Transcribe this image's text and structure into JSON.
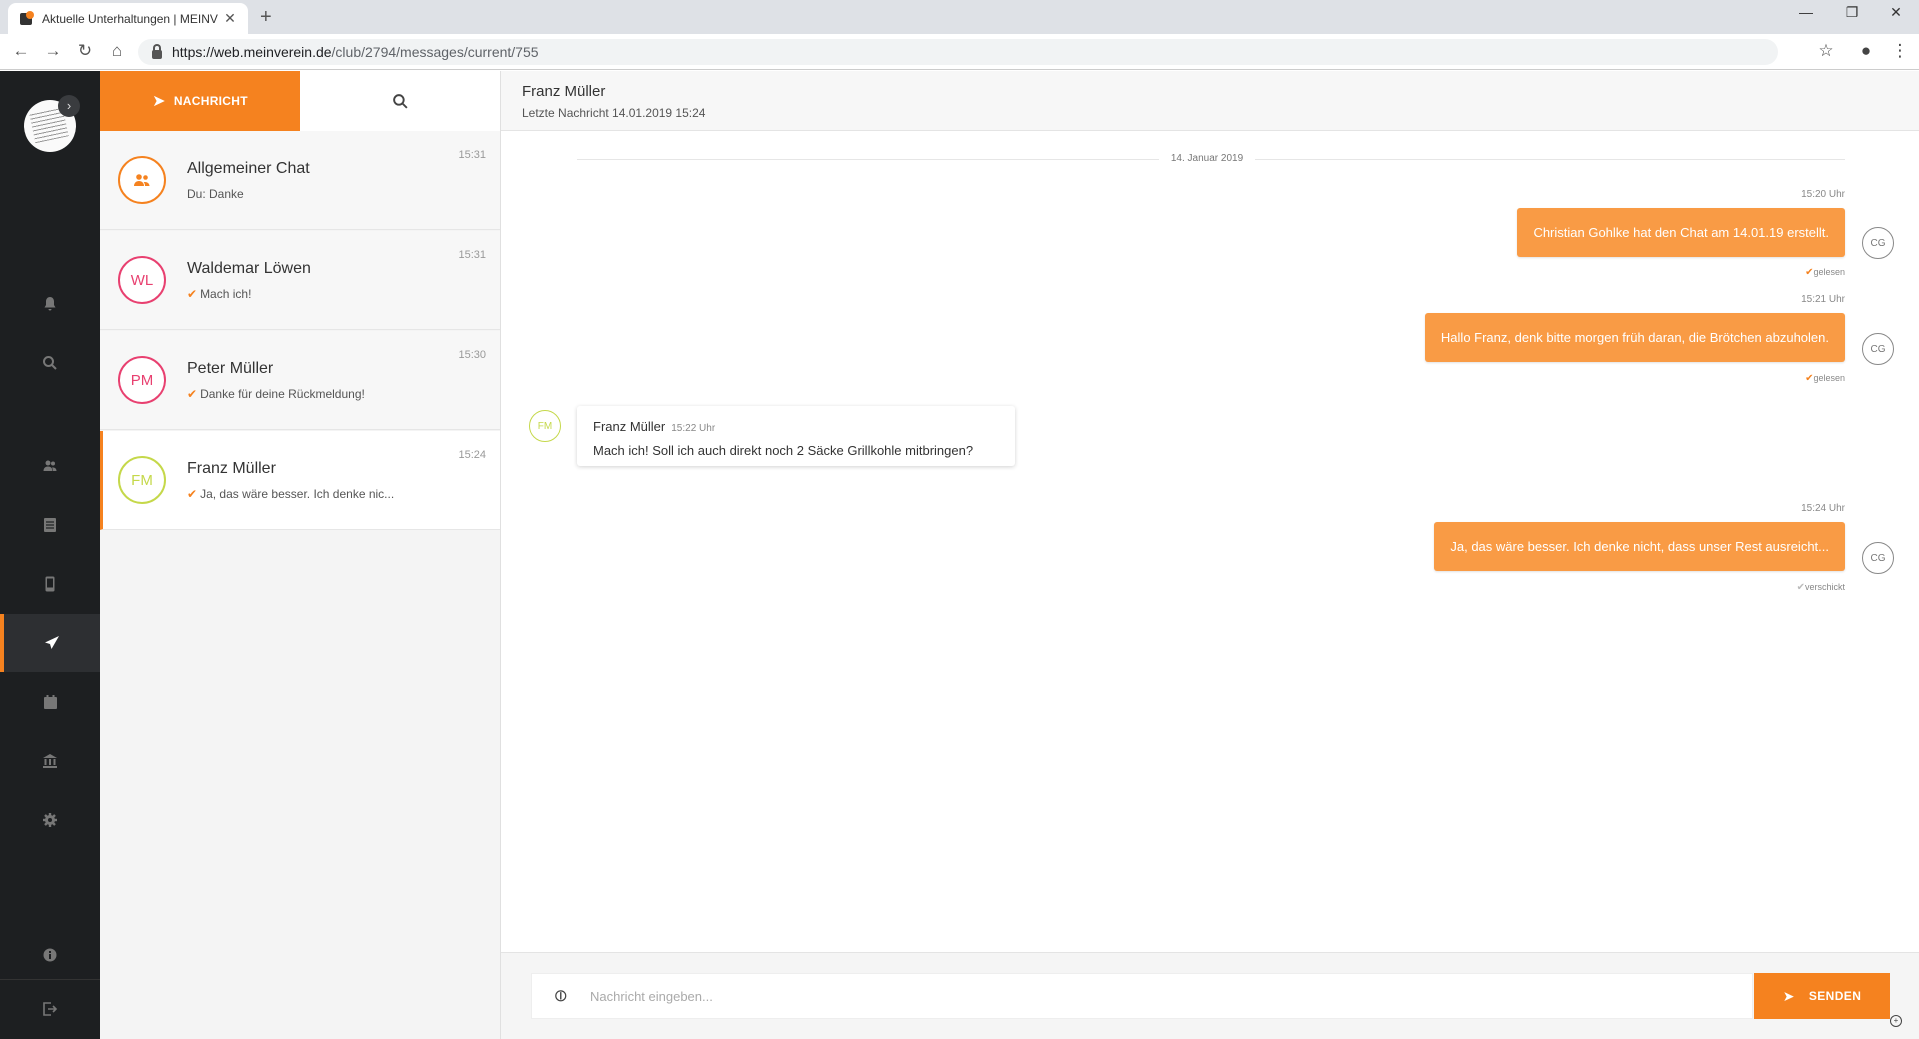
{
  "browser": {
    "tab_title": "Aktuelle Unterhaltungen | MEINV",
    "url_host": "https://web.meinverein.de",
    "url_path": "/club/2794/messages/current/755"
  },
  "sidebar": {
    "items": [
      {
        "icon": "bell-icon"
      },
      {
        "icon": "search-icon"
      },
      {
        "icon": "users-icon"
      },
      {
        "icon": "list-icon"
      },
      {
        "icon": "phone-icon"
      },
      {
        "icon": "send-icon"
      },
      {
        "icon": "calendar-icon"
      },
      {
        "icon": "bank-icon"
      },
      {
        "icon": "gear-icon"
      },
      {
        "icon": "info-icon"
      },
      {
        "icon": "logout-icon"
      }
    ]
  },
  "convlist": {
    "new_message_label": "NACHRICHT",
    "conversations": [
      {
        "name": "Allgemeiner Chat",
        "preview": "Du: Danke",
        "time": "15:31",
        "initials": ""
      },
      {
        "name": "Waldemar Löwen",
        "preview": "Mach ich!",
        "time": "15:31",
        "initials": "WL"
      },
      {
        "name": "Peter Müller",
        "preview": "Danke für deine Rückmeldung!",
        "time": "15:30",
        "initials": "PM"
      },
      {
        "name": "Franz Müller",
        "preview": "Ja, das wäre besser. Ich denke nic...",
        "time": "15:24",
        "initials": "FM"
      }
    ]
  },
  "chat": {
    "title": "Franz Müller",
    "subtitle": "Letzte Nachricht 14.01.2019 15:24",
    "date_separator": "14. Januar 2019",
    "messages": [
      {
        "time": "15:20 Uhr",
        "text": "Christian Gohlke hat den Chat am 14.01.19 erstellt.",
        "status": "gelesen",
        "avatar": "CG"
      },
      {
        "time": "15:21 Uhr",
        "text": "Hallo Franz, denk bitte morgen früh daran, die Brötchen abzuholen.",
        "status": "gelesen",
        "avatar": "CG"
      },
      {
        "sender": "Franz Müller",
        "time": "15:22 Uhr",
        "text": "Mach ich! Soll ich auch direkt noch 2 Säcke Grillkohle mitbringen?",
        "avatar": "FM"
      },
      {
        "time": "15:24 Uhr",
        "text": "Ja, das wäre besser. Ich denke nicht, dass unser Rest ausreicht...",
        "status": "verschickt",
        "avatar": "CG"
      }
    ],
    "composer": {
      "placeholder": "Nachricht eingeben...",
      "send_label": "SENDEN"
    }
  },
  "colors": {
    "accent": "#f5821f",
    "bubble_out": "#f99b45",
    "sidebar_bg": "#1d1f21",
    "avatar_pink": "#e84070",
    "avatar_lime": "#c5d84a"
  }
}
